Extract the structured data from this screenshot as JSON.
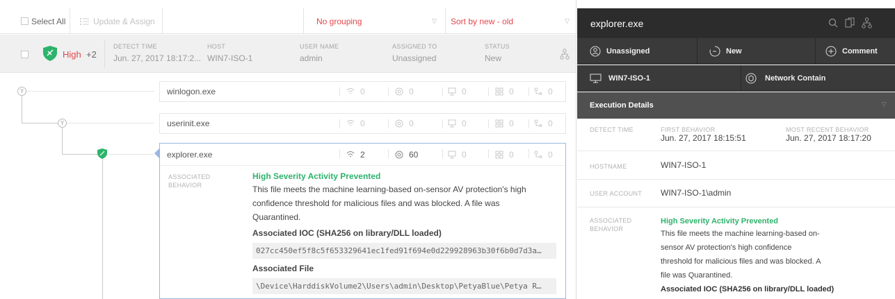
{
  "toolbar": {
    "select_all": "Select All",
    "update_assign": "Update & Assign",
    "grouping": "No grouping",
    "sort": "Sort by new - old"
  },
  "detection": {
    "severity": "High",
    "extra_count": "+2",
    "columns": [
      {
        "header": "DETECT TIME",
        "value": "Jun. 27, 2017 18:17:2..."
      },
      {
        "header": "HOST",
        "value": "WIN7-ISO-1"
      },
      {
        "header": "USER NAME",
        "value": "admin"
      },
      {
        "header": "ASSIGNED TO",
        "value": "Unassigned"
      },
      {
        "header": "STATUS",
        "value": "New"
      }
    ]
  },
  "processes": [
    {
      "name": "winlogon.exe",
      "counts": [
        "0",
        "0",
        "0",
        "0",
        "0"
      ]
    },
    {
      "name": "userinit.exe",
      "counts": [
        "0",
        "0",
        "0",
        "0",
        "0"
      ]
    },
    {
      "name": "explorer.exe",
      "counts": [
        "2",
        "60",
        "0",
        "0",
        "0"
      ]
    }
  ],
  "details": {
    "label_associated": "ASSOCIATED",
    "label_behavior": "BEHAVIOR",
    "title": "High Severity Activity Prevented",
    "description_lines": [
      "This file meets the machine learning-based on-sensor AV protection's high",
      "confidence threshold for malicious files and was blocked. A file was",
      "Quarantined."
    ],
    "ioc_label": "Associated IOC (SHA256 on library/DLL loaded)",
    "ioc_value": "027cc450ef5f8c5f653329641ec1fed91f694e0d229928963b30f6b0d7d3a…",
    "file_label": "Associated File",
    "file_value": "\\Device\\HarddiskVolume2\\Users\\admin\\Desktop\\PetyaBlue\\Petya R…"
  },
  "panel": {
    "title": "explorer.exe",
    "assignee": "Unassigned",
    "status": "New",
    "comment": "Comment",
    "host": "WIN7-ISO-1",
    "network_contain": "Network Contain",
    "section_title": "Execution Details",
    "detect_time_label": "DETECT TIME",
    "first_behavior_label": "FIRST BEHAVIOR",
    "first_behavior_value": "Jun. 27, 2017 18:15:51",
    "recent_behavior_label": "MOST RECENT BEHAVIOR",
    "recent_behavior_value": "Jun. 27, 2017 18:17:20",
    "hostname_label": "HOSTNAME",
    "hostname_value": "WIN7-ISO-1",
    "user_account_label": "USER ACCOUNT",
    "user_account_value": "WIN7-ISO-1\\admin",
    "assoc_label_1": "ASSOCIATED",
    "assoc_label_2": "BEHAVIOR",
    "assoc_title": "High Severity Activity Prevented",
    "assoc_lines": [
      "This file meets the machine learning-based on-",
      "sensor AV protection's high confidence",
      "threshold for malicious files and was blocked. A",
      "file was Quarantined."
    ],
    "ioc_label": "Associated IOC (SHA256 on library/DLL loaded)"
  },
  "colors": {
    "accent_red": "#e0474c",
    "success_green": "#2db36b",
    "panel_dark": "#3a3a3a",
    "selected_border": "#9ab7e0"
  },
  "icons": [
    "checkbox-icon",
    "list-icon",
    "shield-icon",
    "process-tree-icon",
    "network-icon",
    "dns-icon",
    "disk-icon",
    "file-icon",
    "registry-icon",
    "search-icon",
    "copy-icon",
    "user-icon",
    "status-circle-icon",
    "plus-circle-icon",
    "monitor-icon",
    "network-contain-icon",
    "chevron-down-icon"
  ]
}
